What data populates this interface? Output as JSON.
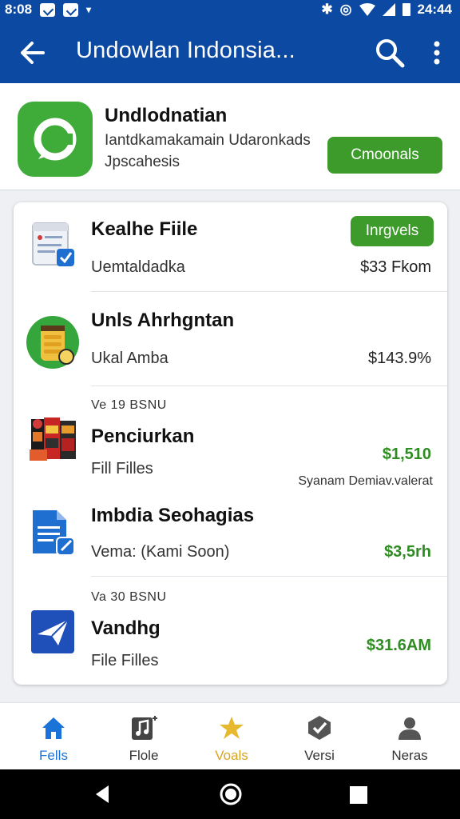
{
  "status_bar": {
    "time_left": "8:08",
    "time_right": "24:44"
  },
  "app_bar": {
    "title": "Undowlan Indonsia..."
  },
  "hero": {
    "title": "Undlodnatian",
    "subtitle_line1": "Iantdkamakamain Udaronkads",
    "subtitle_line2": "Jpscahesis",
    "button_label": "Cmoonals"
  },
  "list": [
    {
      "title": "Kealhe Fiile",
      "subtitle": "Uemtaldadka",
      "price": "$33 Fkom",
      "badge": "Inrgvels",
      "icon": "document-check-icon"
    },
    {
      "title": "Unls Ahrhgntan",
      "subtitle": "Ukal Amba",
      "price": "$143.9%",
      "icon": "food-jar-icon"
    },
    {
      "overline": "Ve 19 BSNU",
      "title": "Penciurkan",
      "subtitle": "Fill Filles",
      "price": "$1,510",
      "note": "Syanam  Demiav.valerat",
      "icon": "groceries-icon"
    },
    {
      "title": "Imbdia Seohagias",
      "subtitle": "Vema: (Kami  Soon)",
      "price": "$3,5rh",
      "icon": "document-edit-icon"
    },
    {
      "overline": "Va 30 BSNU",
      "title": "Vandhg",
      "subtitle": "File Filles",
      "price": "$31.6AM",
      "icon": "send-plane-icon"
    }
  ],
  "bottom_nav": [
    {
      "label": "Fells",
      "icon": "home-icon",
      "active": true
    },
    {
      "label": "Flole",
      "icon": "music-note-icon"
    },
    {
      "label": "Voals",
      "icon": "star-icon",
      "highlight": true
    },
    {
      "label": "Versi",
      "icon": "check-badge-icon"
    },
    {
      "label": "Neras",
      "icon": "person-icon"
    }
  ],
  "colors": {
    "primary": "#0b49a3",
    "accent_green": "#3d9b2b",
    "nav_active": "#1a73d9",
    "nav_highlight": "#e6b92e"
  }
}
